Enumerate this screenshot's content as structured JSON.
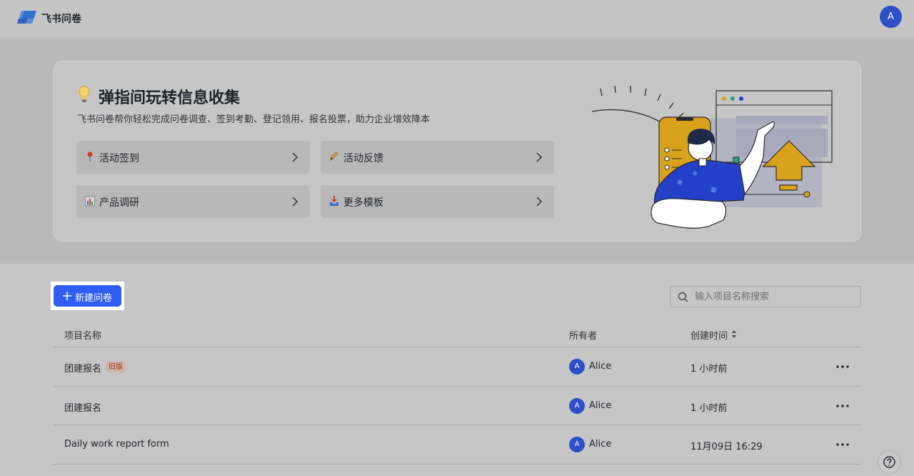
{
  "header": {
    "app_title": "飞书问卷",
    "avatar_letter": "A",
    "logo_icon": "feishu-forms-logo"
  },
  "banner": {
    "title": "弹指间玩转信息收集",
    "subtitle": "飞书问卷帮你轻松完成问卷调查、签到考勤、登记领用、报名投票，助力企业增效降本",
    "title_icon": "lightbulb-icon",
    "tiles": [
      {
        "label": "活动签到",
        "icon": "pin-icon"
      },
      {
        "label": "活动反馈",
        "icon": "pencil-icon"
      },
      {
        "label": "产品调研",
        "icon": "bar-chart-icon"
      },
      {
        "label": "更多模板",
        "icon": "inbox-tray-icon"
      }
    ]
  },
  "toolbar": {
    "new_button_label": "新建问卷",
    "search_placeholder": "输入项目名称搜索"
  },
  "table": {
    "columns": {
      "name": "项目名称",
      "owner": "所有者",
      "created": "创建时间"
    },
    "rows": [
      {
        "name": "团建报名",
        "tag": "旧版",
        "owner_initial": "A",
        "owner": "Alice",
        "created": "1 小时前"
      },
      {
        "name": "团建报名",
        "tag": "",
        "owner_initial": "A",
        "owner": "Alice",
        "created": "1 小时前"
      },
      {
        "name": "Daily work report form",
        "tag": "",
        "owner_initial": "A",
        "owner": "Alice",
        "created": "11月09日 16:29"
      }
    ]
  },
  "colors": {
    "primary": "#2f5ef5",
    "avatar": "#2b50c8",
    "illustration_yellow": "#d9a21b",
    "illustration_blue": "#2440c8"
  }
}
